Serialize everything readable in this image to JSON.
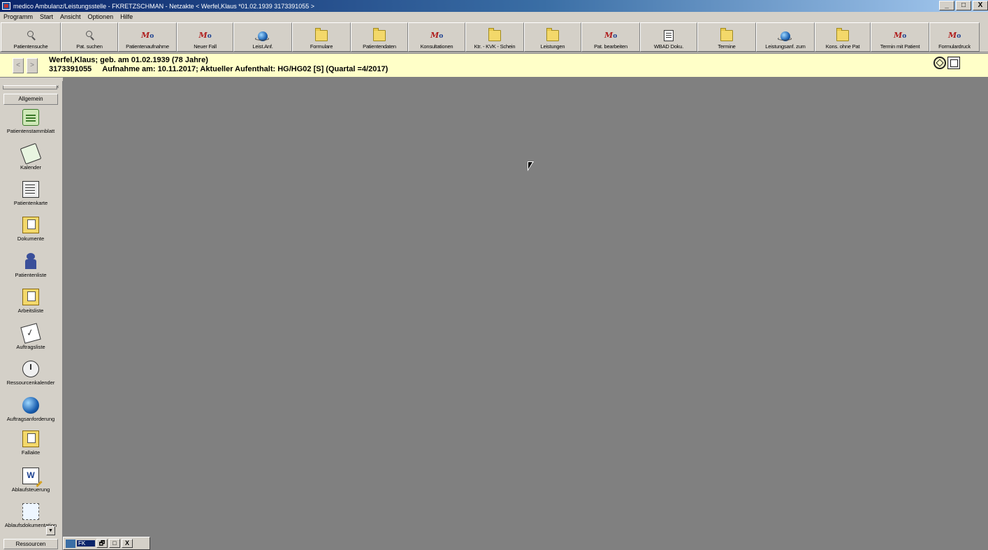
{
  "window": {
    "title": "medico Ambulanz/Leistungsstelle  -  FKRETZSCHMAN  -  Netzakte  < Werfel,Klaus  *01.02.1939  3173391055 >",
    "minimize": "_",
    "maximize": "□",
    "close": "X"
  },
  "menu": [
    "Programm",
    "Start",
    "Ansicht",
    "Optionen",
    "Hilfe"
  ],
  "toolbar": [
    {
      "label": "Patientensuche",
      "icon": "magnifier-icon"
    },
    {
      "label": "Pat. suchen",
      "icon": "magnifier-icon"
    },
    {
      "label": "Patientenaufnahme",
      "icon": "medico-icon"
    },
    {
      "label": "Neuer Fall",
      "icon": "medico-icon"
    },
    {
      "label": "Leist.Anf.",
      "icon": "globe-icon"
    },
    {
      "label": "Formulare",
      "icon": "folder-icon"
    },
    {
      "label": "Patientendaten",
      "icon": "folder-icon"
    },
    {
      "label": "Konsultationen",
      "icon": "medico-icon"
    },
    {
      "label": "Ktr. - KVK - Schein",
      "icon": "folder-icon"
    },
    {
      "label": "Leistungen",
      "icon": "folder-icon"
    },
    {
      "label": "Pat. bearbeiten",
      "icon": "medico-icon"
    },
    {
      "label": "WBAD Doku.",
      "icon": "document-icon"
    },
    {
      "label": "Termine",
      "icon": "folder-icon"
    },
    {
      "label": "Leistungsanf. zum",
      "icon": "globe-icon"
    },
    {
      "label": "Kons. ohne Pat",
      "icon": "folder-icon"
    },
    {
      "label": "Termin mit Patient",
      "icon": "medico-icon"
    },
    {
      "label": "Formulardruck",
      "icon": "medico-icon"
    }
  ],
  "patient": {
    "back": "<",
    "forward": ">",
    "line1": "Werfel,Klaus; geb. am 01.02.1939 (78 Jahre)",
    "id": "3173391055",
    "line2": "Aufnahme am: 10.11.2017; Aktueller Aufenthalt: HG/HG02  [S]  (Quartal =4/2017)"
  },
  "sidebar": {
    "header": "Allgemein",
    "items": [
      {
        "label": "Patientenstammblatt",
        "icon": "patient-master-icon"
      },
      {
        "label": "Kalender",
        "icon": "calendar-icon"
      },
      {
        "label": "Patientenkarte",
        "icon": "patient-card-icon"
      },
      {
        "label": "Dokumente",
        "icon": "documents-folder-icon"
      },
      {
        "label": "Patientenliste",
        "icon": "people-icon"
      },
      {
        "label": "Arbeitsliste",
        "icon": "worklist-folder-icon"
      },
      {
        "label": "Auftragsliste",
        "icon": "clipboard-check-icon"
      },
      {
        "label": "Ressourcenkalender",
        "icon": "resource-calendar-icon"
      },
      {
        "label": "Auftragsanforderung",
        "icon": "globe-icon"
      },
      {
        "label": "Fallakte",
        "icon": "case-folder-icon"
      },
      {
        "label": "Ablaufsteuerung",
        "icon": "word-document-icon"
      },
      {
        "label": "Ablaufsdokumentation",
        "icon": "workflow-doc-icon"
      }
    ],
    "footer": "Ressourcen",
    "scroll_down": "▼",
    "close": "×"
  },
  "minimized_window": {
    "title": "FK",
    "restore": "🗗",
    "maximize": "□",
    "close": "X"
  }
}
